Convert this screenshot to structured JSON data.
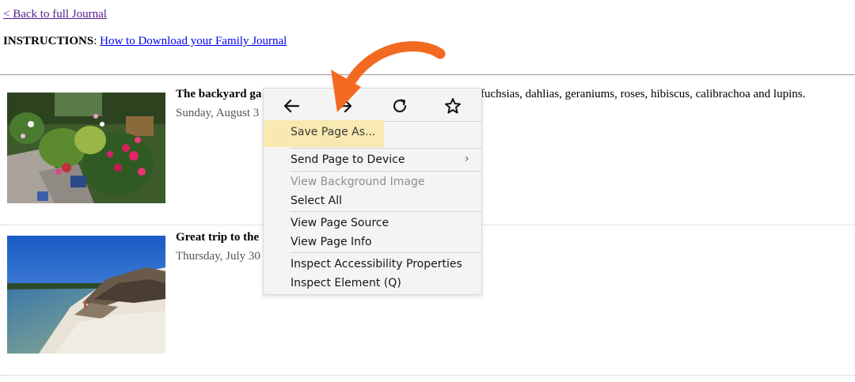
{
  "header": {
    "back_link": "< Back to full Journal",
    "instructions_label": "INSTRUCTIONS",
    "instructions_sep": ":",
    "instructions_link": "How to Download your Family Journal"
  },
  "entries": [
    {
      "title": "The backyard ga",
      "date": "Sunday, August 3",
      "tail": "fuchsias, dahlias, geraniums, roses, hibiscus, calibrachoa and lupins."
    },
    {
      "title": "Great trip to the",
      "date": "Thursday, July 30"
    }
  ],
  "context_menu": {
    "nav_icons": [
      "back-arrow-icon",
      "forward-arrow-icon",
      "reload-icon",
      "bookmark-star-icon"
    ],
    "items": [
      {
        "label": "Save Page As...",
        "highlighted": true
      },
      {
        "label": "Send Page to Device",
        "submenu": true
      },
      {
        "label": "View Background Image",
        "disabled": true
      },
      {
        "label": "Select All"
      },
      {
        "label": "View Page Source"
      },
      {
        "label": "View Page Info"
      },
      {
        "label": "Inspect Accessibility Properties"
      },
      {
        "label": "Inspect Element (Q)"
      }
    ],
    "submenu_glyph": "›"
  },
  "colors": {
    "highlight": "#f7e9b0",
    "annotation_arrow": "#f26a21",
    "link": "#0000ee",
    "visited_link": "#551a8b"
  }
}
